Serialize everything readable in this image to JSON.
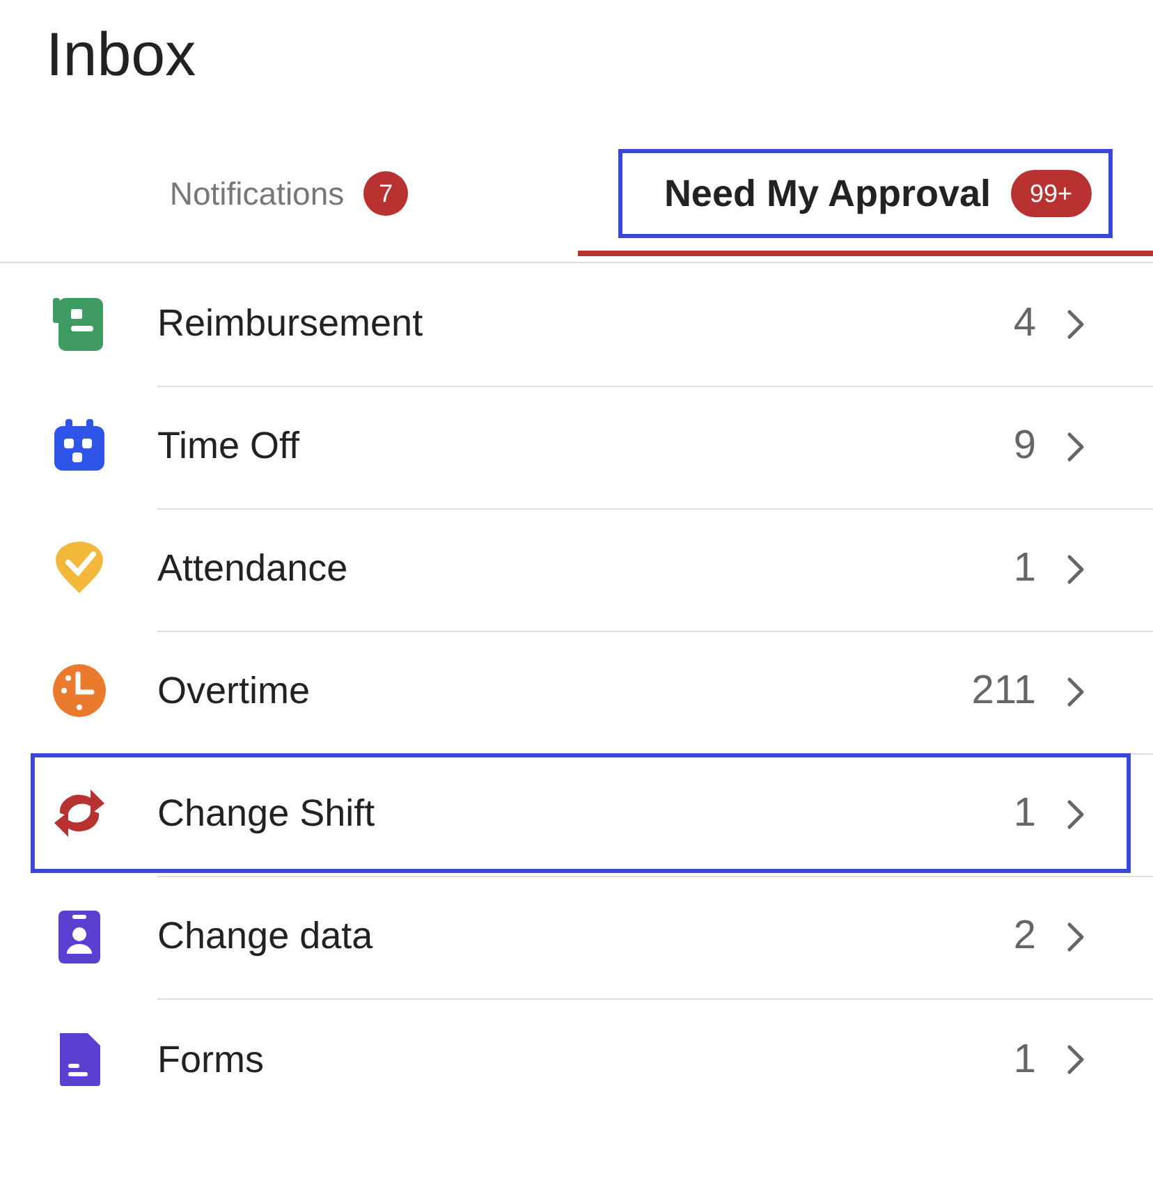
{
  "title": "Inbox",
  "tabs": [
    {
      "label": "Notifications",
      "badge": "7",
      "selected": false,
      "highlighted": false
    },
    {
      "label": "Need My Approval",
      "badge": "99+",
      "selected": true,
      "highlighted": true
    }
  ],
  "items": [
    {
      "kind": "receipt",
      "label": "Reimbursement",
      "count": "4",
      "color": "#3f9b62",
      "highlighted": false
    },
    {
      "kind": "calendar",
      "label": "Time Off",
      "count": "9",
      "color": "#2f55e8",
      "highlighted": false
    },
    {
      "kind": "pin",
      "label": "Attendance",
      "count": "1",
      "color": "#f2b83a",
      "highlighted": false
    },
    {
      "kind": "clock",
      "label": "Overtime",
      "count": "211",
      "color": "#ea7a2e",
      "highlighted": false
    },
    {
      "kind": "swap",
      "label": "Change Shift",
      "count": "1",
      "color": "#b83232",
      "highlighted": true
    },
    {
      "kind": "badge",
      "label": "Change data",
      "count": "2",
      "color": "#5b3fd0",
      "highlighted": false
    },
    {
      "kind": "doc",
      "label": "Forms",
      "count": "1",
      "color": "#5b3fd0",
      "highlighted": false
    }
  ]
}
